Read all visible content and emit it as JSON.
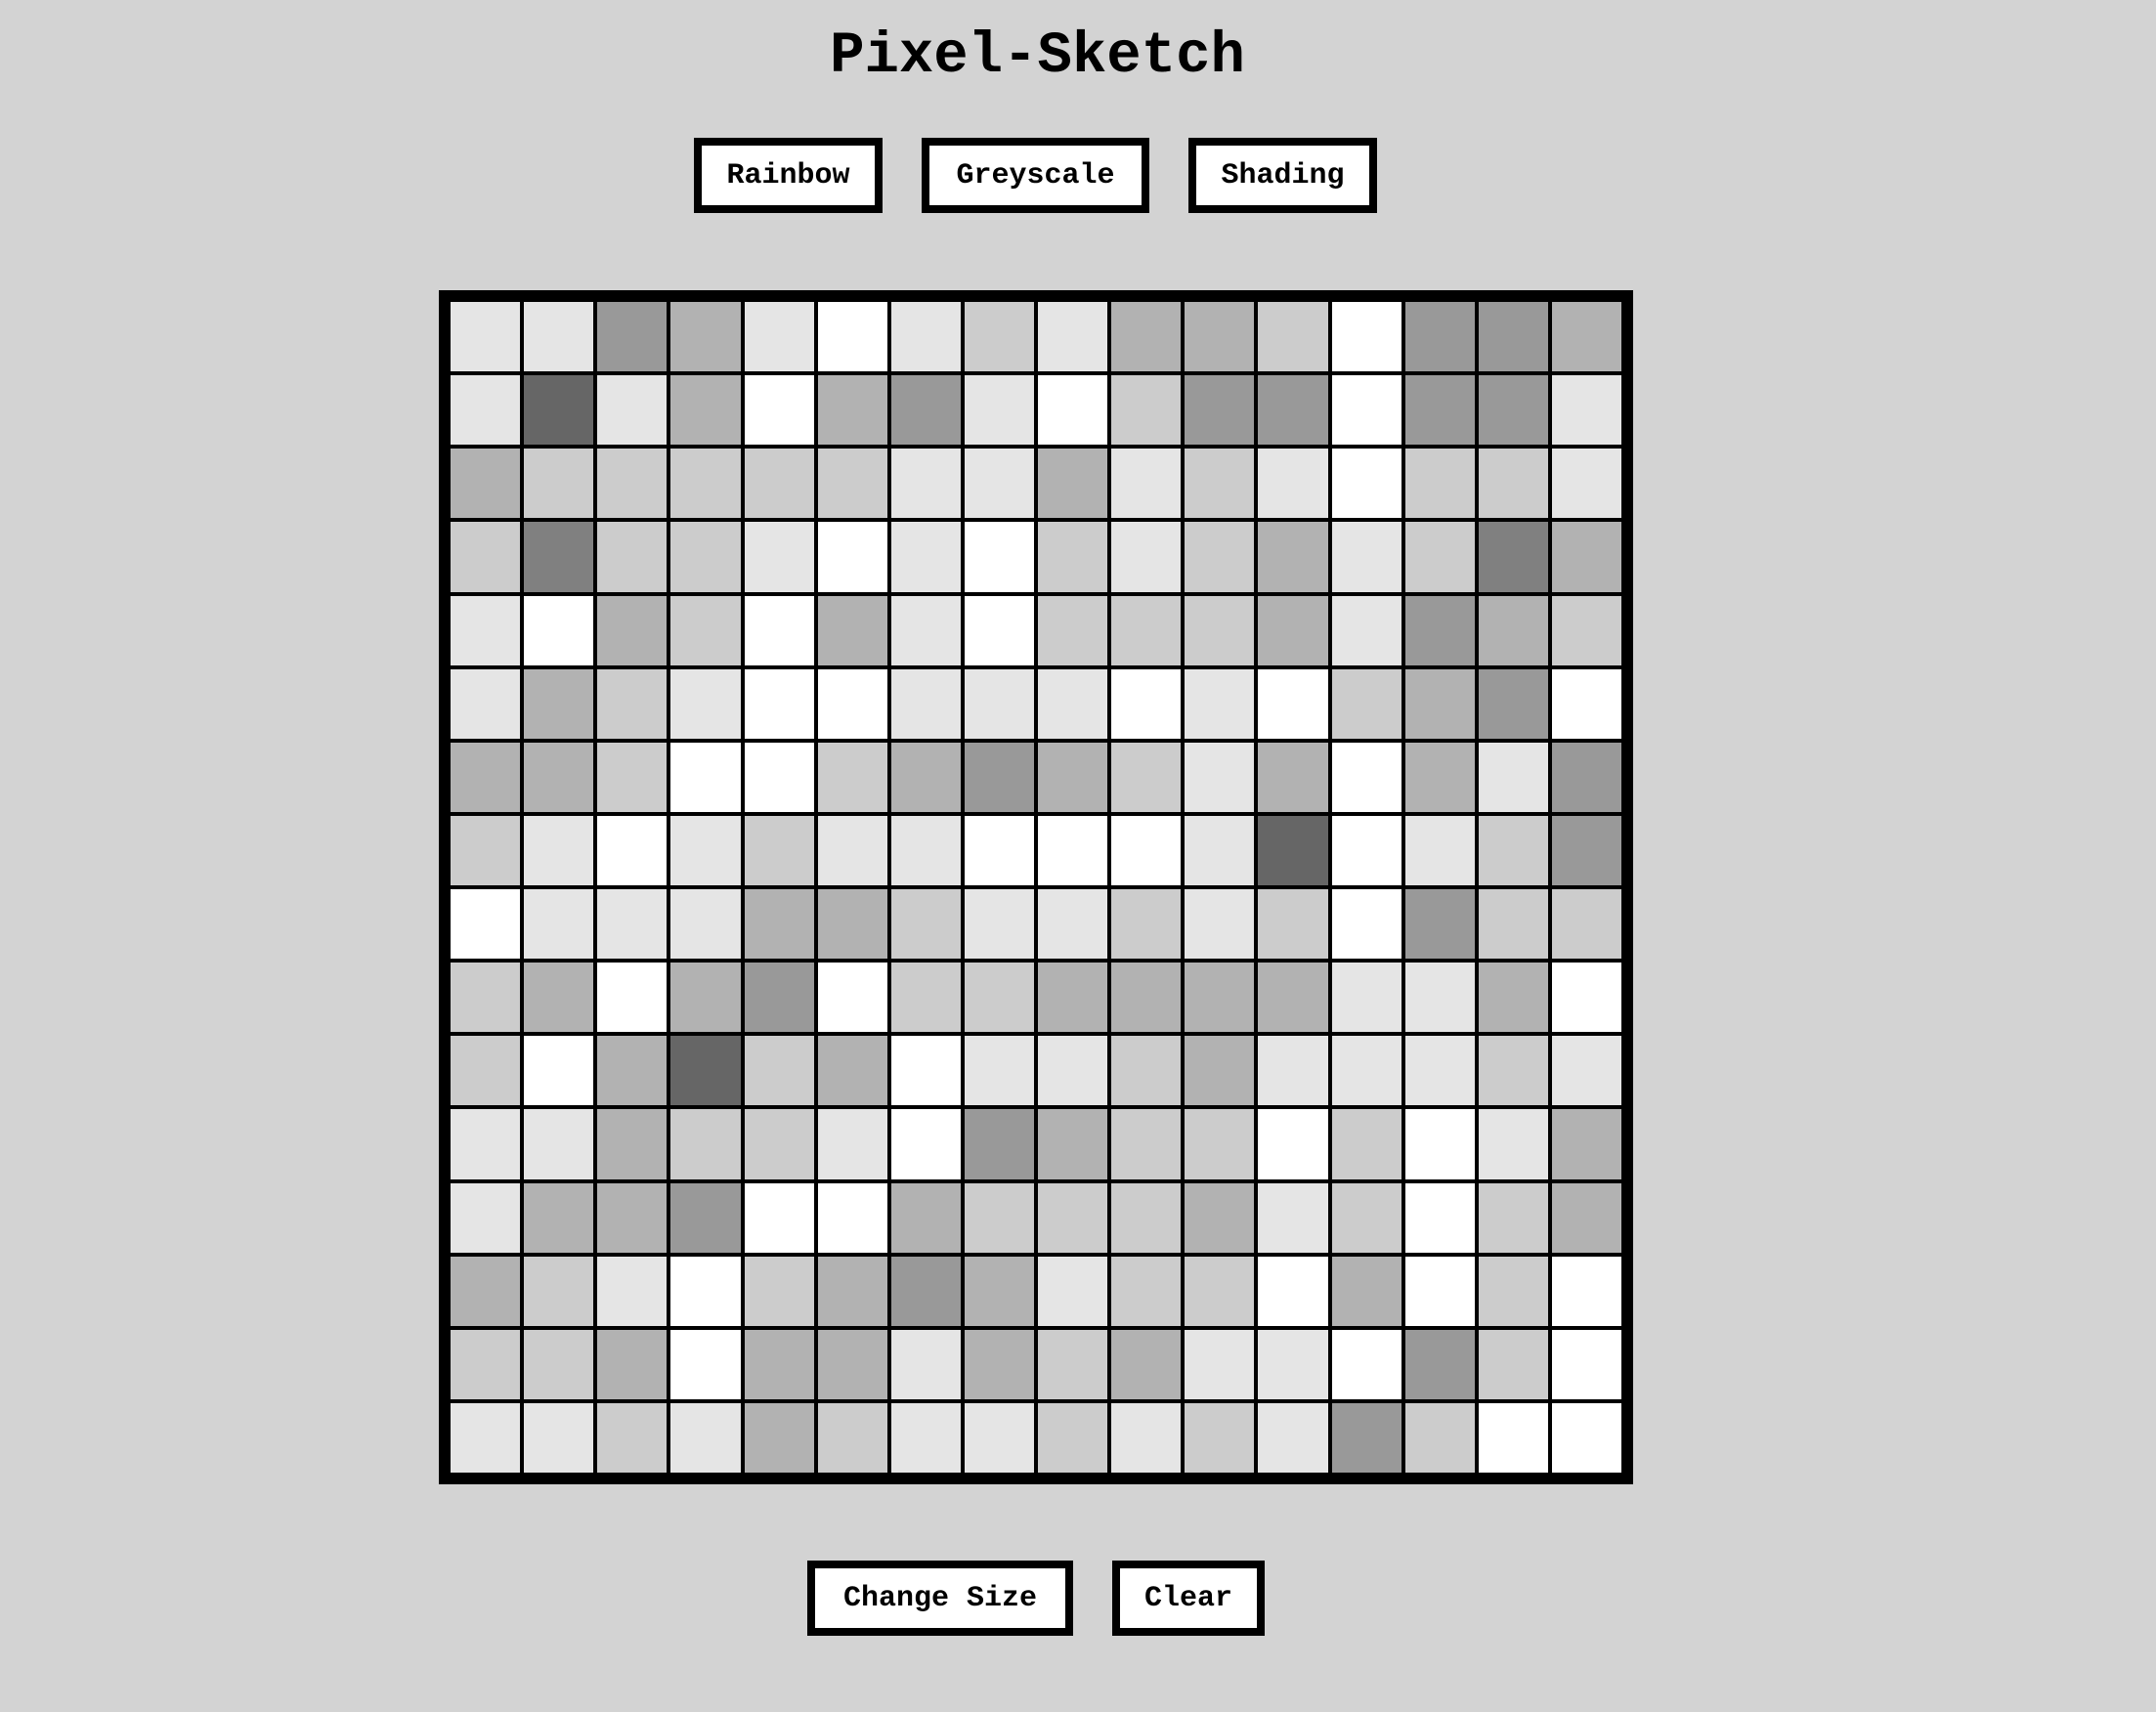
{
  "app": {
    "title": "Pixel-Sketch"
  },
  "modes": {
    "rainbow_label": "Rainbow",
    "greyscale_label": "Greyscale",
    "shading_label": "Shading"
  },
  "controls": {
    "change_size_label": "Change Size",
    "clear_label": "Clear"
  },
  "colors": {
    "background": "#d3d3d3",
    "border": "#000000",
    "button_fill": "#ffffff"
  },
  "grid": {
    "rows": 16,
    "cols": 16,
    "shade_palette": [
      "#ffffff",
      "#e5e5e5",
      "#cccccc",
      "#b2b2b2",
      "#999999",
      "#808080",
      "#666666"
    ],
    "cells": [
      [
        1,
        1,
        4,
        3,
        1,
        0,
        1,
        2,
        1,
        3,
        3,
        2,
        0,
        4,
        4,
        3
      ],
      [
        1,
        6,
        1,
        3,
        0,
        3,
        4,
        1,
        0,
        2,
        4,
        4,
        0,
        4,
        4,
        1
      ],
      [
        3,
        2,
        2,
        2,
        2,
        2,
        1,
        1,
        3,
        1,
        2,
        1,
        0,
        2,
        2,
        1
      ],
      [
        2,
        5,
        2,
        2,
        1,
        0,
        1,
        0,
        2,
        1,
        2,
        3,
        1,
        2,
        5,
        3
      ],
      [
        1,
        0,
        3,
        2,
        0,
        3,
        1,
        0,
        2,
        2,
        2,
        3,
        1,
        4,
        3,
        2
      ],
      [
        1,
        3,
        2,
        1,
        0,
        0,
        1,
        1,
        1,
        0,
        1,
        0,
        2,
        3,
        4,
        0
      ],
      [
        3,
        3,
        2,
        0,
        0,
        2,
        3,
        4,
        3,
        2,
        1,
        3,
        0,
        3,
        1,
        4
      ],
      [
        2,
        1,
        0,
        1,
        2,
        1,
        1,
        0,
        0,
        0,
        1,
        6,
        0,
        1,
        2,
        4
      ],
      [
        0,
        1,
        1,
        1,
        3,
        3,
        2,
        1,
        1,
        2,
        1,
        2,
        0,
        4,
        2,
        2
      ],
      [
        2,
        3,
        0,
        3,
        4,
        0,
        2,
        2,
        3,
        3,
        3,
        3,
        1,
        1,
        3,
        0
      ],
      [
        2,
        0,
        3,
        6,
        2,
        3,
        0,
        1,
        1,
        2,
        3,
        1,
        1,
        1,
        2,
        1
      ],
      [
        1,
        1,
        3,
        2,
        2,
        1,
        0,
        4,
        3,
        2,
        2,
        0,
        2,
        0,
        1,
        3
      ],
      [
        1,
        3,
        3,
        4,
        0,
        0,
        3,
        2,
        2,
        2,
        3,
        1,
        2,
        0,
        2,
        3
      ],
      [
        3,
        2,
        1,
        0,
        2,
        3,
        4,
        3,
        1,
        2,
        2,
        0,
        3,
        0,
        2,
        0
      ],
      [
        2,
        2,
        3,
        0,
        3,
        3,
        1,
        3,
        2,
        3,
        1,
        1,
        0,
        4,
        2,
        0
      ],
      [
        1,
        1,
        2,
        1,
        3,
        2,
        1,
        1,
        2,
        1,
        2,
        1,
        4,
        2,
        0,
        0
      ]
    ]
  }
}
